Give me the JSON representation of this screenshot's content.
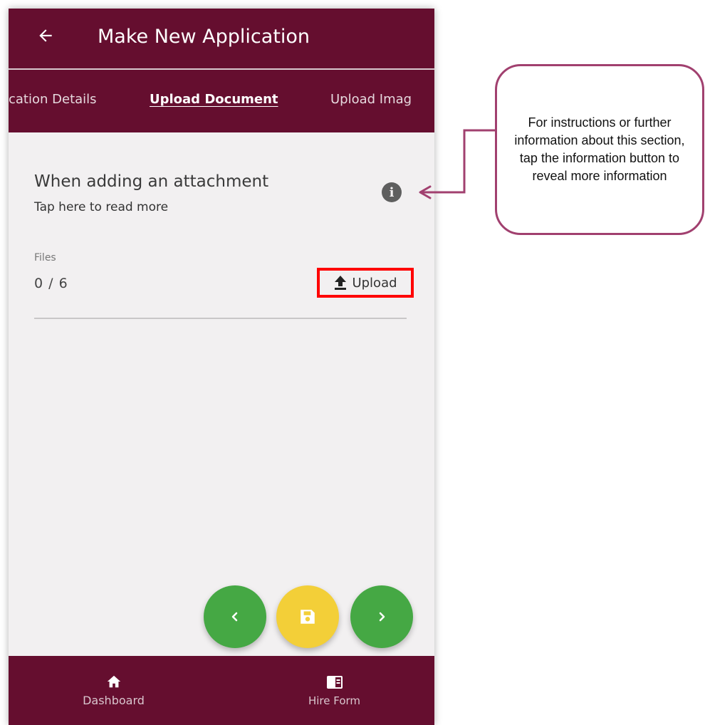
{
  "app": {
    "title": "Make New Application"
  },
  "tabs": [
    {
      "label": "cation Details",
      "active": false
    },
    {
      "label": "Upload Document",
      "active": true
    },
    {
      "label": "Upload Imag",
      "active": false
    }
  ],
  "section": {
    "heading": "When adding an attachment",
    "subheading": "Tap here to read more"
  },
  "files": {
    "label": "Files",
    "count": "0 / 6",
    "upload_label": "Upload"
  },
  "bottom_nav": [
    {
      "label": "Dashboard",
      "icon": "home-icon"
    },
    {
      "label": "Hire Form",
      "icon": "form-icon"
    }
  ],
  "callout": {
    "text": "For instructions or further information about this section, tap the information button to reveal more information"
  },
  "colors": {
    "brand": "#650e2f",
    "nav_green": "#45a844",
    "save_yellow": "#f3cf38",
    "highlight_red": "#ff0000",
    "callout_border": "#a1406f"
  }
}
